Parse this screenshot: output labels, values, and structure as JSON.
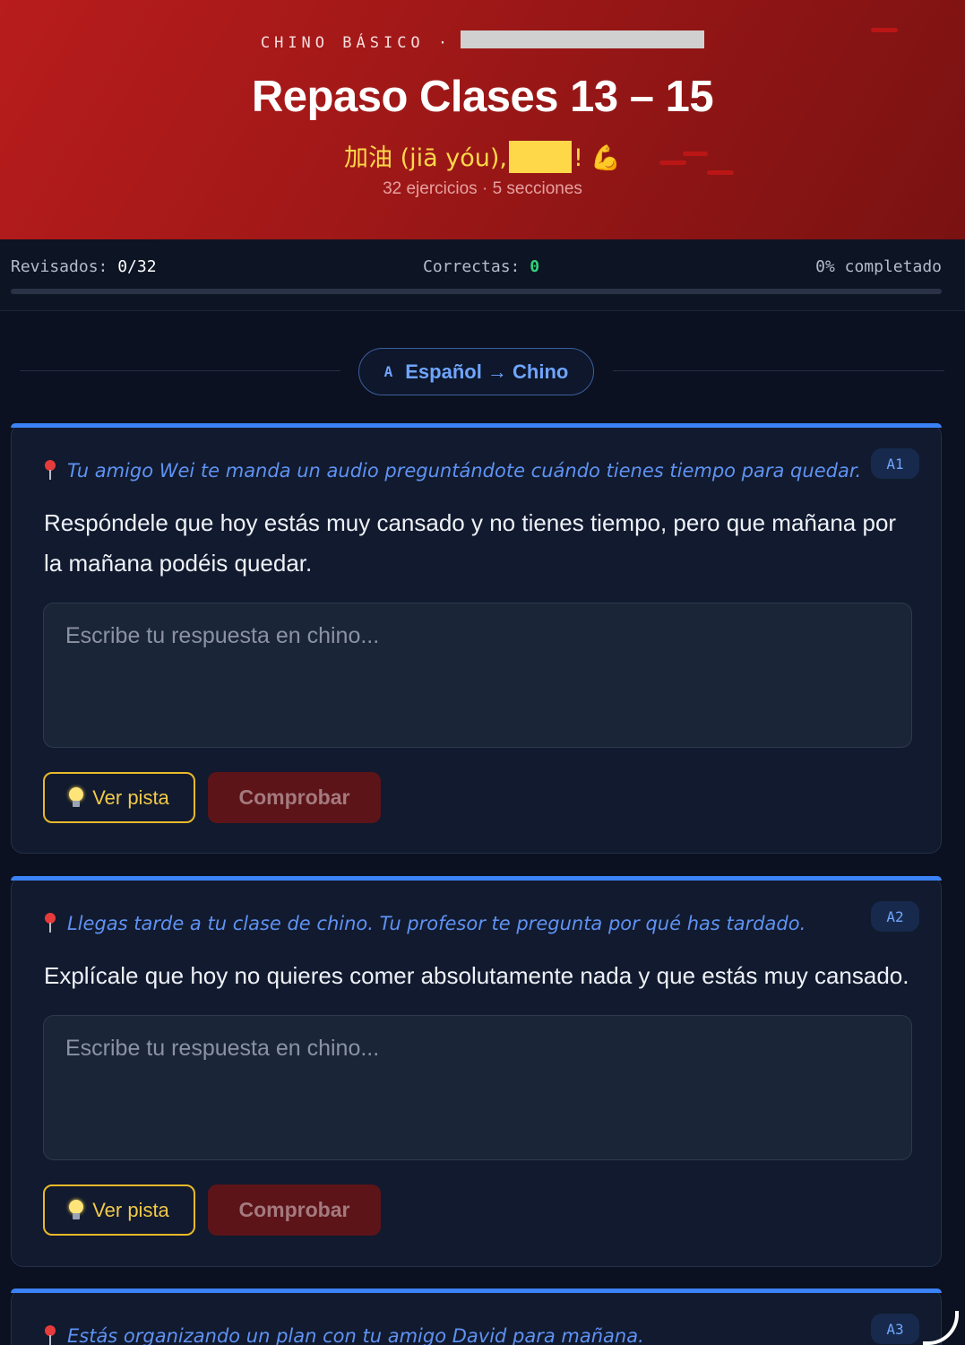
{
  "header": {
    "kicker": "CHINO BÁSICO ·",
    "title": "Repaso Clases 13 – 15",
    "cheer_prefix": "加油 (jiā yóu),",
    "cheer_suffix": "! 💪",
    "meta": "32 ejercicios · 5 secciones"
  },
  "stats": {
    "reviewed_label": "Revisados:",
    "reviewed_value": "0/32",
    "correct_label": "Correctas:",
    "correct_value": "0",
    "completed_label": "0% completado",
    "progress_fraction": 0
  },
  "section": {
    "icon": "A",
    "label": "Español → Chino"
  },
  "exercises": [
    {
      "level": "A1",
      "context": "Tu amigo Wei te manda un audio preguntándote cuándo tienes tiempo para quedar.",
      "prompt": "Respóndele que hoy estás muy cansado y no tienes tiempo, pero que mañana por la mañana podéis quedar.",
      "placeholder": "Escribe tu respuesta en chino...",
      "hint_label": "Ver pista",
      "check_label": "Comprobar"
    },
    {
      "level": "A2",
      "context": "Llegas tarde a tu clase de chino. Tu profesor te pregunta por qué has tardado.",
      "prompt": "Explícale que hoy no quieres comer absolutamente nada y que estás muy cansado.",
      "placeholder": "Escribe tu respuesta en chino...",
      "hint_label": "Ver pista",
      "check_label": "Comprobar"
    },
    {
      "level": "A3",
      "context": "Estás organizando un plan con tu amigo David para mañana."
    }
  ],
  "colors": {
    "header_red": "#b81c1c",
    "accent_blue": "#3b82f6",
    "hint_yellow": "#e9b92a",
    "check_red": "#5c1419",
    "correct_green": "#35d07a"
  },
  "icons": [
    "pin-icon",
    "bulb-icon",
    "flexed-biceps-icon",
    "text-a-icon",
    "arrow-right-icon"
  ]
}
